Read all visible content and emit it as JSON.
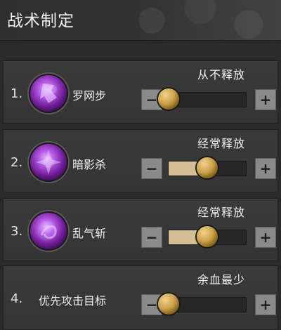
{
  "header": {
    "title": "战术制定"
  },
  "skills": [
    {
      "index": "1.",
      "name": "罗网步",
      "mode": "从不释放",
      "level": 0.0,
      "icon": "purple-skill-icon-1"
    },
    {
      "index": "2.",
      "name": "暗影杀",
      "mode": "经常释放",
      "level": 0.5,
      "icon": "purple-skill-icon-2"
    },
    {
      "index": "3.",
      "name": "乱气斩",
      "mode": "经常释放",
      "level": 0.5,
      "icon": "purple-skill-icon-3"
    }
  ],
  "target": {
    "index": "4.",
    "name": "优先攻击目标",
    "mode": "余血最少",
    "level": 0.0
  },
  "controls": {
    "minus": "−",
    "plus": "+"
  },
  "colors": {
    "fill": "#d2bd95",
    "thumb": "#caa04a"
  }
}
